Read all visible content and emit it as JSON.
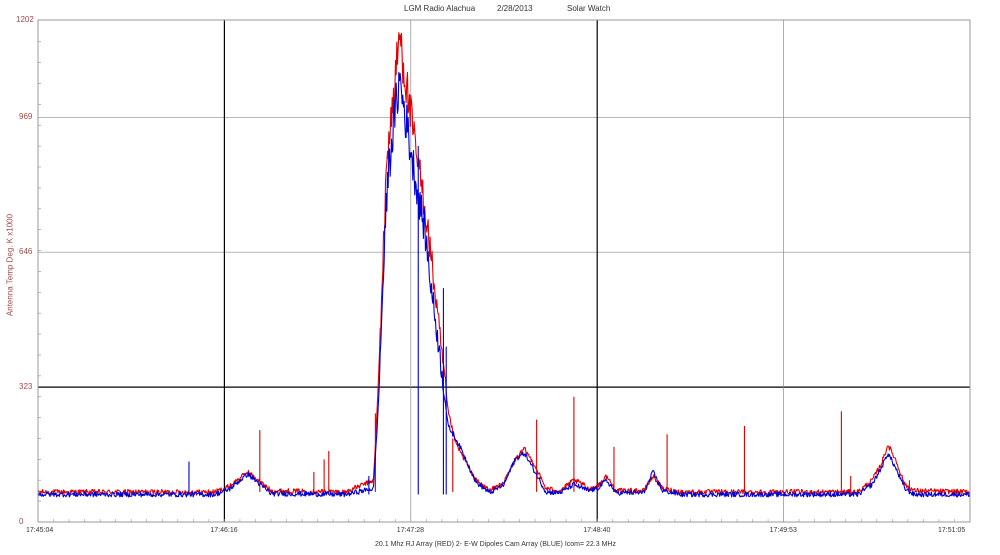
{
  "header": {
    "station": "LGM Radio Alachua",
    "date": "2/28/2013",
    "program": "Solar Watch"
  },
  "chart_data": {
    "type": "line",
    "ylabel": "Antenna Temp Deg. K x1000",
    "xlabel": "20.1 Mhz RJ Array (RED)     2- E-W Dipoles Cam Array (BLUE) Icom= 22.3 MHz",
    "yticks": [
      0,
      323,
      646,
      969,
      1202
    ],
    "xticks": [
      "17:45:04",
      "17:46:16",
      "17:47:28",
      "17:48:40",
      "17:49:53",
      "17:51:05"
    ],
    "ylim": [
      0,
      1202
    ],
    "xlim_minutes": [
      0,
      6.0167
    ],
    "grid": true,
    "series": [
      {
        "color": "#e00000",
        "baseline": 72,
        "noise": 6,
        "points": [
          [
            0,
            72
          ],
          [
            1.9,
            72
          ],
          [
            2.05,
            85
          ],
          [
            2.25,
            120
          ],
          [
            2.5,
            75
          ],
          [
            3.3,
            72
          ],
          [
            3.6,
            100
          ],
          [
            3.65,
            320
          ],
          [
            3.7,
            620
          ],
          [
            3.75,
            900
          ],
          [
            3.82,
            1020
          ],
          [
            3.88,
            1170
          ],
          [
            3.95,
            1050
          ],
          [
            4.05,
            890
          ],
          [
            4.15,
            760
          ],
          [
            4.22,
            630
          ],
          [
            4.3,
            470
          ],
          [
            4.4,
            265
          ],
          [
            4.48,
            190
          ],
          [
            4.55,
            160
          ],
          [
            4.7,
            100
          ],
          [
            4.85,
            75
          ],
          [
            5.0,
            95
          ],
          [
            5.12,
            150
          ],
          [
            5.22,
            175
          ],
          [
            5.32,
            140
          ],
          [
            5.45,
            80
          ],
          [
            5.6,
            75
          ],
          [
            5.75,
            100
          ],
          [
            5.85,
            90
          ],
          [
            5.9,
            80
          ],
          [
            6.0,
            85
          ],
          [
            6.1,
            110
          ],
          [
            6.2,
            75
          ],
          [
            6.5,
            75
          ],
          [
            6.6,
            110
          ],
          [
            6.7,
            80
          ],
          [
            6.9,
            72
          ],
          [
            8.5,
            72
          ],
          [
            8.8,
            72
          ],
          [
            8.95,
            100
          ],
          [
            9.05,
            140
          ],
          [
            9.12,
            185
          ],
          [
            9.2,
            150
          ],
          [
            9.3,
            90
          ],
          [
            9.4,
            75
          ],
          [
            10.0,
            72
          ]
        ],
        "spikes": [
          [
            2.38,
            220
          ],
          [
            3.07,
            150
          ],
          [
            3.12,
            170
          ],
          [
            3.62,
            260
          ],
          [
            5.35,
            245
          ],
          [
            5.75,
            300
          ],
          [
            6.18,
            180
          ],
          [
            6.75,
            210
          ],
          [
            7.58,
            230
          ],
          [
            8.62,
            265
          ],
          [
            9.35,
            100
          ],
          [
            8.72,
            110
          ],
          [
            4.45,
            200
          ],
          [
            2.96,
            120
          ]
        ]
      },
      {
        "color": "#0000d8",
        "baseline": 66,
        "noise": 6,
        "points": [
          [
            0,
            66
          ],
          [
            1.9,
            66
          ],
          [
            2.05,
            78
          ],
          [
            2.25,
            115
          ],
          [
            2.5,
            68
          ],
          [
            3.3,
            66
          ],
          [
            3.6,
            80
          ],
          [
            3.65,
            270
          ],
          [
            3.7,
            560
          ],
          [
            3.75,
            820
          ],
          [
            3.82,
            960
          ],
          [
            3.88,
            1060
          ],
          [
            3.95,
            960
          ],
          [
            4.05,
            820
          ],
          [
            4.15,
            700
          ],
          [
            4.22,
            560
          ],
          [
            4.3,
            420
          ],
          [
            4.4,
            230
          ],
          [
            4.48,
            200
          ],
          [
            4.55,
            170
          ],
          [
            4.7,
            95
          ],
          [
            4.85,
            70
          ],
          [
            5.0,
            90
          ],
          [
            5.12,
            150
          ],
          [
            5.22,
            165
          ],
          [
            5.32,
            125
          ],
          [
            5.45,
            72
          ],
          [
            5.6,
            70
          ],
          [
            5.75,
            90
          ],
          [
            5.85,
            80
          ],
          [
            5.9,
            75
          ],
          [
            6.0,
            80
          ],
          [
            6.1,
            100
          ],
          [
            6.2,
            70
          ],
          [
            6.5,
            70
          ],
          [
            6.6,
            120
          ],
          [
            6.7,
            75
          ],
          [
            6.9,
            66
          ],
          [
            8.5,
            66
          ],
          [
            8.8,
            66
          ],
          [
            8.95,
            90
          ],
          [
            9.05,
            130
          ],
          [
            9.12,
            165
          ],
          [
            9.2,
            130
          ],
          [
            9.3,
            80
          ],
          [
            9.4,
            66
          ],
          [
            10.0,
            66
          ]
        ],
        "spikes": [
          [
            1.62,
            145
          ],
          [
            3.55,
            110
          ],
          [
            4.08,
            900
          ],
          [
            4.35,
            560
          ],
          [
            4.38,
            420
          ]
        ]
      }
    ]
  }
}
